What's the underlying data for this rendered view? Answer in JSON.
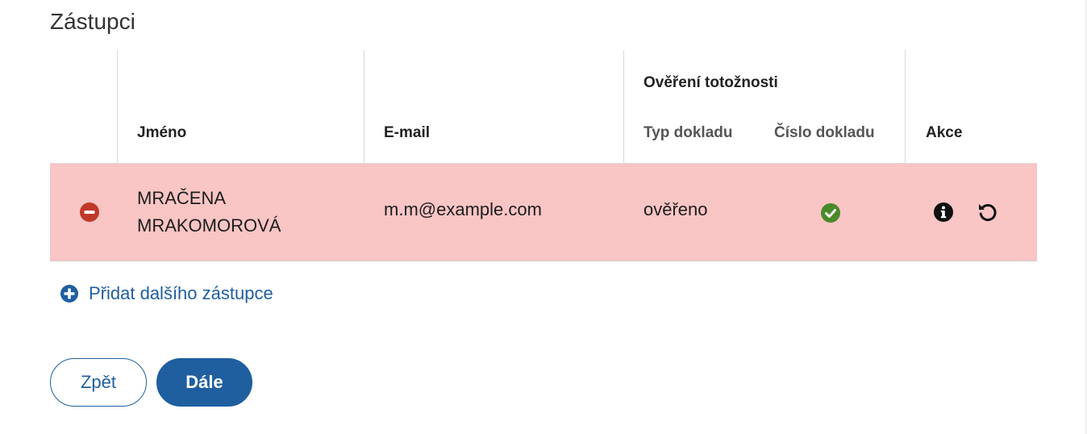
{
  "section": {
    "title": "Zástupci"
  },
  "table": {
    "group_header": "Ověření totožnosti",
    "columns": {
      "name": "Jméno",
      "email": "E-mail",
      "doc_type": "Typ dokladu",
      "doc_number": "Číslo dokladu",
      "actions": "Akce"
    },
    "rows": [
      {
        "name_line1": "MRAČENA",
        "name_line2": "MRAKOMOROVÁ",
        "email": "m.m@example.com",
        "doc_type": "ověřeno",
        "doc_number_status": "verified",
        "status": "marked-for-removal"
      }
    ]
  },
  "actions": {
    "add_label": "Přidat dalšího zástupce",
    "back_label": "Zpět",
    "next_label": "Dále"
  },
  "icons": {
    "remove": "minus-circle-icon",
    "check": "check-circle-icon",
    "info": "info-circle-icon",
    "undo": "undo-icon",
    "add": "plus-circle-icon"
  },
  "colors": {
    "primary": "#1f5fa0",
    "row_highlight": "#f9c5c5",
    "remove_icon": "#c0392b",
    "check_icon": "#4a8a2a"
  }
}
